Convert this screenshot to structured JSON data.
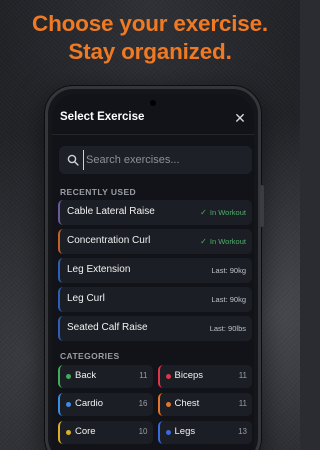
{
  "headline": {
    "line1": "Choose your exercise.",
    "line2": "Stay organized."
  },
  "modal": {
    "title": "Select Exercise",
    "close_icon": "close-icon",
    "search": {
      "placeholder": "Search exercises...",
      "icon": "search-icon"
    },
    "recent_label": "RECENTLY USED",
    "recent": [
      {
        "name": "Cable Lateral Raise",
        "status": "In Workout",
        "in_workout": true,
        "accent": "#6a5a9c"
      },
      {
        "name": "Concentration Curl",
        "status": "In Workout",
        "in_workout": true,
        "accent": "#c4602a"
      },
      {
        "name": "Leg Extension",
        "status": "Last: 90kg",
        "in_workout": false,
        "accent": "#2e5fb8"
      },
      {
        "name": "Leg Curl",
        "status": "Last: 90kg",
        "in_workout": false,
        "accent": "#2e5fb8"
      },
      {
        "name": "Seated Calf Raise",
        "status": "Last: 90lbs",
        "in_workout": false,
        "accent": "#2e5fb8"
      }
    ],
    "categories_label": "CATEGORIES",
    "categories": [
      {
        "name": "Back",
        "count": "11",
        "color": "#3fae58"
      },
      {
        "name": "Biceps",
        "count": "11",
        "color": "#e0344a"
      },
      {
        "name": "Cardio",
        "count": "16",
        "color": "#3a8ee0"
      },
      {
        "name": "Chest",
        "count": "11",
        "color": "#e0772a"
      },
      {
        "name": "Core",
        "count": "10",
        "color": "#d8b02a"
      },
      {
        "name": "Legs",
        "count": "13",
        "color": "#3a6ae0"
      }
    ]
  },
  "colors": {
    "accent_orange": "#f07a24",
    "in_workout_green": "#4caf6a"
  }
}
